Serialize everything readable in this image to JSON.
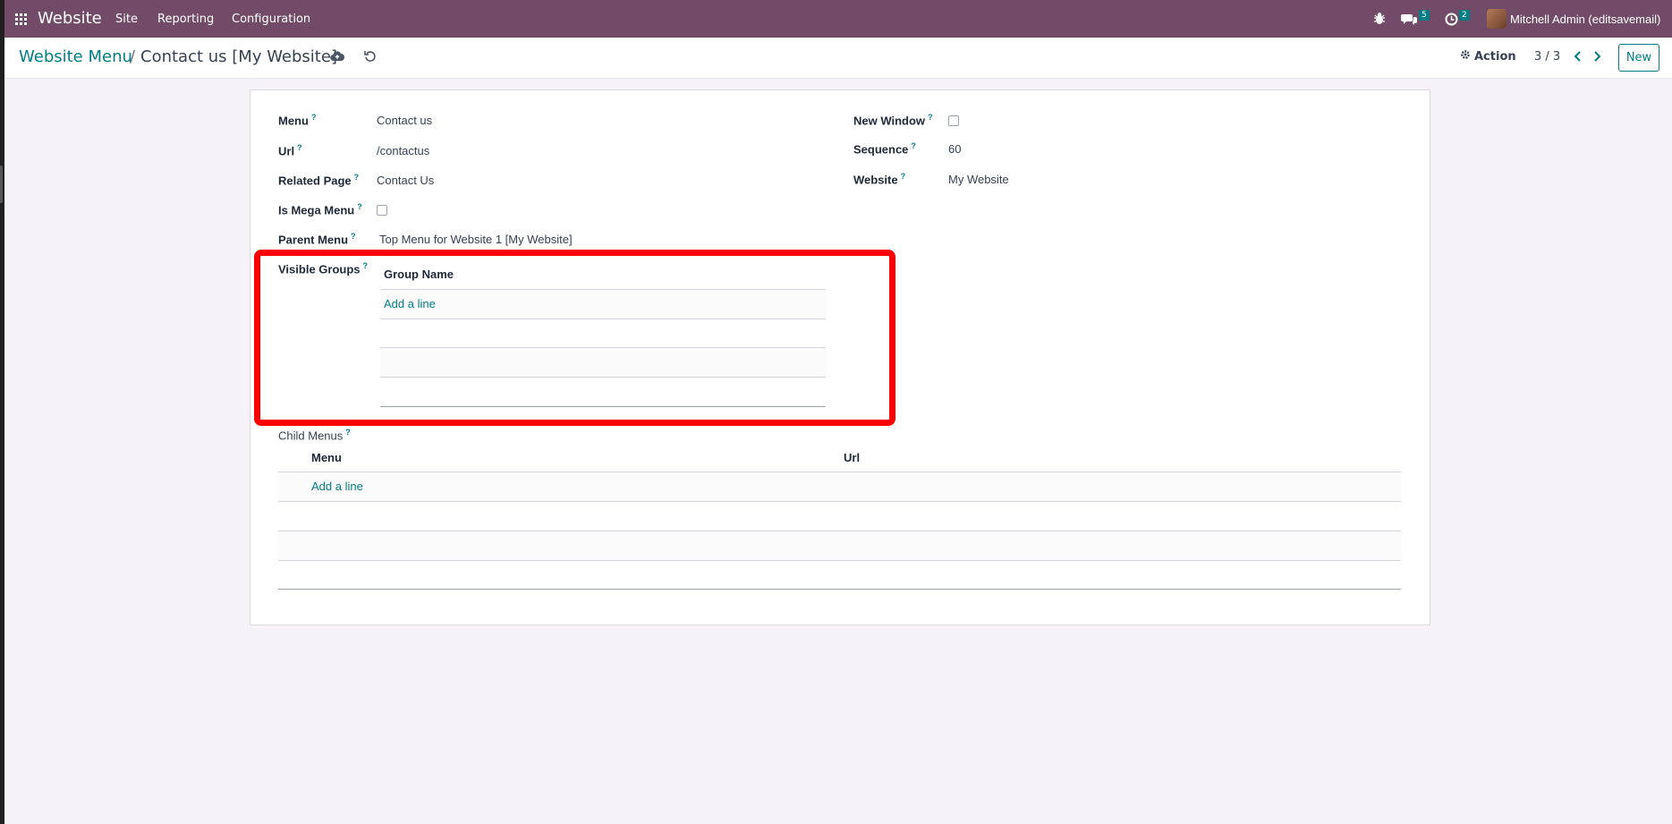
{
  "navbar": {
    "brand": "Website",
    "menu": [
      "Site",
      "Reporting",
      "Configuration"
    ],
    "messages_count": "5",
    "activities_count": "2",
    "user": "Mitchell Admin (editsavemail)"
  },
  "breadcrumb": {
    "parent": "Website Menu",
    "separator": "/",
    "current": "Contact us [My Website]"
  },
  "control": {
    "action_label": "Action",
    "pager": "3 / 3",
    "new_label": "New"
  },
  "form": {
    "menu_label": "Menu",
    "menu_value": "Contact us",
    "url_label": "Url",
    "url_value": "/contactus",
    "related_page_label": "Related Page",
    "related_page_value": "Contact Us",
    "mega_menu_label": "Is Mega Menu",
    "parent_menu_label": "Parent Menu",
    "parent_menu_value": "Top Menu for Website 1 [My Website]",
    "visible_groups_label": "Visible Groups",
    "new_window_label": "New Window",
    "sequence_label": "Sequence",
    "sequence_value": "60",
    "website_label": "Website",
    "website_value": "My Website",
    "help_mark": "?"
  },
  "visible_groups_table": {
    "header": "Group Name",
    "add_line": "Add a line"
  },
  "child_menus": {
    "label": "Child Menus",
    "headers": [
      "Menu",
      "Url"
    ],
    "add_line": "Add a line"
  },
  "colors": {
    "navbar": "#714b67",
    "accent": "#017e84",
    "highlight": "#ff0000"
  }
}
